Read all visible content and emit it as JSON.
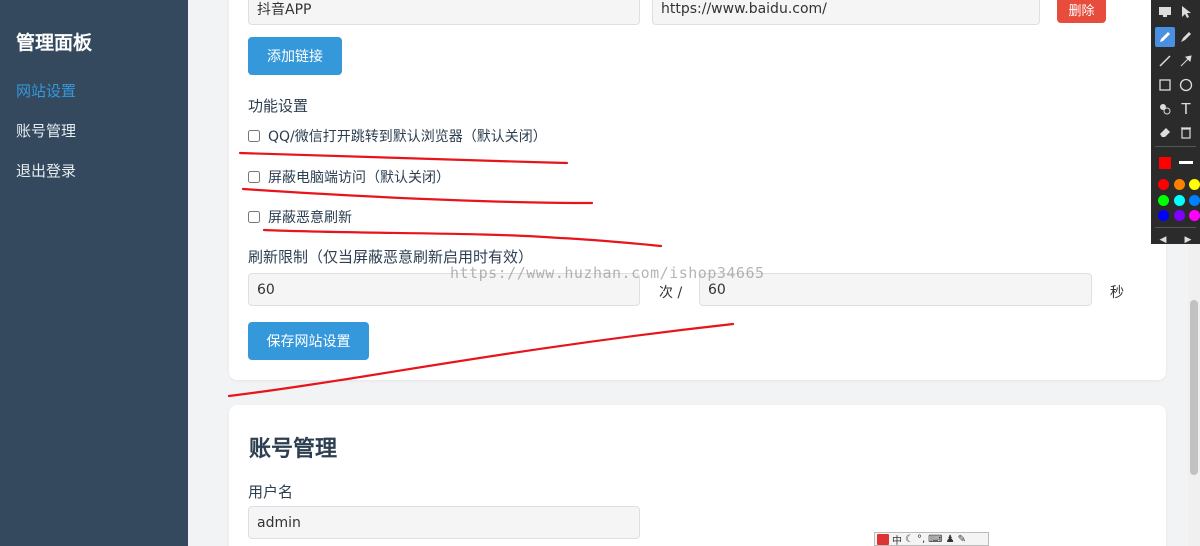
{
  "sidebar": {
    "title": "管理面板",
    "items": [
      {
        "label": "网站设置",
        "active": true
      },
      {
        "label": "账号管理",
        "active": false
      },
      {
        "label": "退出登录",
        "active": false
      }
    ]
  },
  "links_section": {
    "row": {
      "name_value": "抖音APP",
      "url_value": "https://www.baidu.com/",
      "delete_label": "删除"
    },
    "add_link_label": "添加链接"
  },
  "features": {
    "heading": "功能设置",
    "options": [
      {
        "label": "QQ/微信打开跳转到默认浏览器（默认关闭）",
        "checked": false
      },
      {
        "label": "屏蔽电脑端访问（默认关闭）",
        "checked": false
      },
      {
        "label": "屏蔽恶意刷新",
        "checked": false
      }
    ]
  },
  "refresh_limit": {
    "label": "刷新限制（仅当屏蔽恶意刷新启用时有效）",
    "count_value": "60",
    "count_unit": "次 /",
    "seconds_value": "60",
    "seconds_unit": "秒"
  },
  "save_site_label": "保存网站设置",
  "account": {
    "title": "账号管理",
    "username_label": "用户名",
    "username_value": "admin"
  },
  "watermark": "https://www.huzhan.com/ishop34665",
  "colors": {
    "sidebar_bg": "#34495e",
    "accent_blue": "#3498db",
    "danger_red": "#e74c3c",
    "annotation_red": "#e8141b"
  },
  "annotation_toolbar": {
    "tools": [
      "screen-icon",
      "pointer-icon",
      "pencil-icon",
      "marker-icon",
      "line-icon",
      "arrow-icon",
      "rectangle-icon",
      "circle-icon",
      "fill-icon",
      "text-icon",
      "eraser-icon",
      "trash-icon"
    ],
    "swatches": [
      "#ff0000",
      "#ff8000",
      "#ffff00",
      "#00ff00",
      "#00ffff",
      "#0080ff",
      "#0000ff",
      "#8000ff",
      "#ff00ff"
    ]
  },
  "ime_bar": {
    "label": "中"
  }
}
